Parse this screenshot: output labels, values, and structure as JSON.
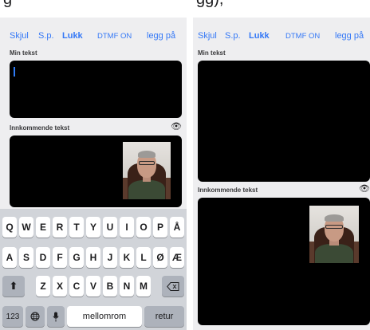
{
  "left": {
    "toolbar": {
      "hide": "Skjul",
      "sp": "S.p.",
      "close": "Lukk",
      "dtmf": "DTMF ON",
      "hangup": "legg på"
    },
    "my_text_label": "Min tekst",
    "my_text_value": "",
    "incoming_label": "Innkommende tekst",
    "keyboard": {
      "row1": [
        "Q",
        "W",
        "E",
        "R",
        "T",
        "Y",
        "U",
        "I",
        "O",
        "P",
        "Å"
      ],
      "row2": [
        "A",
        "S",
        "D",
        "F",
        "G",
        "H",
        "J",
        "K",
        "L",
        "Ø",
        "Æ"
      ],
      "row3": [
        "Z",
        "X",
        "C",
        "V",
        "B",
        "N",
        "M"
      ],
      "shift_icon": "shift-icon",
      "backspace_icon": "backspace-icon",
      "numbers_key": "123",
      "globe_icon": "globe-icon",
      "mic_icon": "microphone-icon",
      "space_key": "mellomrom",
      "return_key": "retur"
    }
  },
  "right": {
    "toolbar": {
      "hide": "Skjul",
      "sp": "S.p.",
      "close": "Lukk",
      "dtmf": "DTMF ON",
      "hangup": "legg på"
    },
    "my_text_label": "Min tekst",
    "incoming_label": "Innkommende tekst"
  },
  "colors": {
    "accent": "#3478f6",
    "panel_bg": "#eeeef0",
    "keyboard_bg": "#d1d4d9"
  }
}
